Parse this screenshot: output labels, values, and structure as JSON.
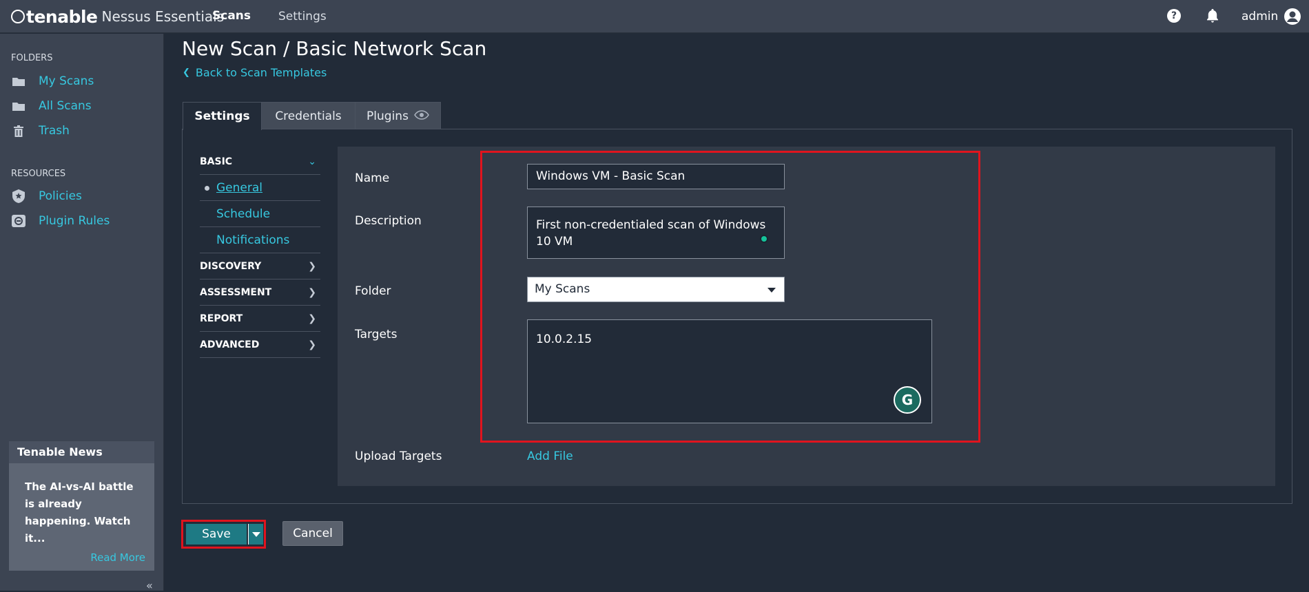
{
  "app": {
    "brand": "tenable",
    "product": "Nessus Essentials"
  },
  "topnav": {
    "scans": "Scans",
    "settings": "Settings",
    "help": "?",
    "user": "admin"
  },
  "sidebar": {
    "folders_heading": "FOLDERS",
    "folders": [
      {
        "label": "My Scans",
        "icon": "folder-icon"
      },
      {
        "label": "All Scans",
        "icon": "folder-icon"
      },
      {
        "label": "Trash",
        "icon": "trash-icon"
      }
    ],
    "resources_heading": "RESOURCES",
    "resources": [
      {
        "label": "Policies",
        "icon": "shield-icon"
      },
      {
        "label": "Plugin Rules",
        "icon": "plugin-rules-icon"
      }
    ],
    "news": {
      "title": "Tenable News",
      "body": "The AI-vs-AI battle is already happening. Watch it...",
      "read_more": "Read More"
    }
  },
  "page": {
    "title": "New Scan / Basic Network Scan",
    "back_link": "Back to Scan Templates"
  },
  "tabs": [
    {
      "label": "Settings",
      "active": true
    },
    {
      "label": "Credentials",
      "active": false
    },
    {
      "label": "Plugins",
      "active": false
    }
  ],
  "subnav": {
    "basic": "BASIC",
    "items": [
      "General",
      "Schedule",
      "Notifications"
    ],
    "active_item": "General",
    "discovery": "DISCOVERY",
    "assessment": "ASSESSMENT",
    "report": "REPORT",
    "advanced": "ADVANCED"
  },
  "form": {
    "name_label": "Name",
    "name_value": "Windows VM - Basic Scan",
    "description_label": "Description",
    "description_value": "First non-credentialed scan of Windows 10 VM",
    "folder_label": "Folder",
    "folder_value": "My Scans",
    "targets_label": "Targets",
    "targets_value": "10.0.2.15",
    "upload_label": "Upload Targets",
    "add_file": "Add File"
  },
  "actions": {
    "save": "Save",
    "cancel": "Cancel"
  },
  "colors": {
    "accent": "#37c8e0",
    "highlight": "#e0141e",
    "save": "#1e7a84",
    "background": "#222b38",
    "chrome": "#3c4452"
  }
}
